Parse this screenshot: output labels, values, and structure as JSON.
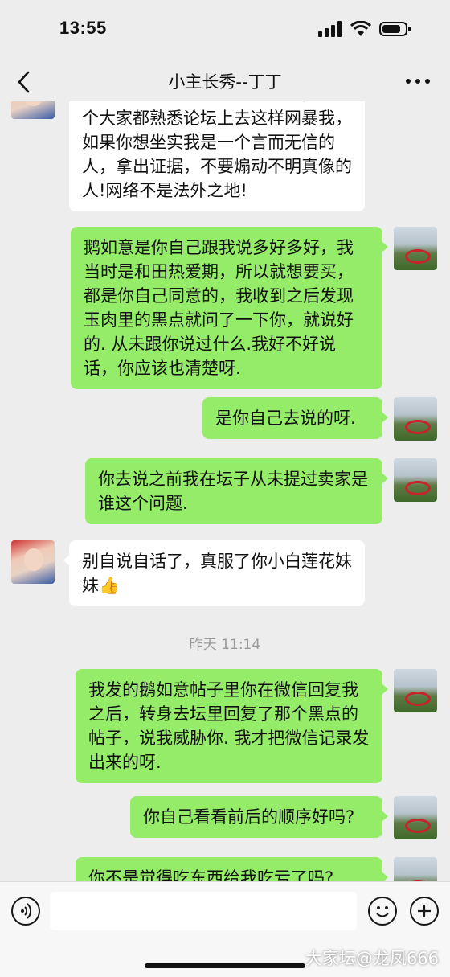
{
  "status_bar": {
    "time": "13:55"
  },
  "header": {
    "title": "小主长秀--丁丁"
  },
  "messages": [
    {
      "side": "left",
      "text": "你是我的朋友？一言一不短短，在一个大家都熟悉论坛上去这样网暴我，如果你想坐实我是一个言而无信的人，拿出证据，不要煽动不明真像的人!网络不是法外之地!"
    },
    {
      "side": "right",
      "text": "鹅如意是你自己跟我说多好多好，我当时是和田热爱期，所以就想要买，都是你自己同意的，我收到之后发现玉肉里的黑点就问了一下你，就说好的. 从未跟你说过什么.我好不好说话，你应该也清楚呀."
    },
    {
      "side": "right",
      "text": "是你自己去说的呀."
    },
    {
      "side": "right",
      "text": "你去说之前我在坛子从未提过卖家是谁这个问题."
    },
    {
      "side": "left",
      "text": "别自说自话了，真服了你小白莲花妹妹👍"
    },
    {
      "side": "right",
      "text": "我发的鹅如意帖子里你在微信回复我之后，转身去坛里回复了那个黑点的帖子，说我威胁你. 我才把微信记录发出来的呀."
    },
    {
      "side": "right",
      "text": "你自己看看前后的顺序好吗?"
    },
    {
      "side": "right",
      "text": "你不是觉得吃东西给我吃亏了吗?"
    }
  ],
  "timestamp_divider": "昨天 11:14",
  "watermark": "大家坛@龙凤666",
  "icons": {
    "back": "chevron-left-icon",
    "more": "more-dots-icon",
    "voice": "voice-icon",
    "emoji": "emoji-icon",
    "plus": "plus-icon"
  },
  "colors": {
    "bubble_self": "#95ec69",
    "bubble_other": "#ffffff",
    "background": "#ededed"
  }
}
